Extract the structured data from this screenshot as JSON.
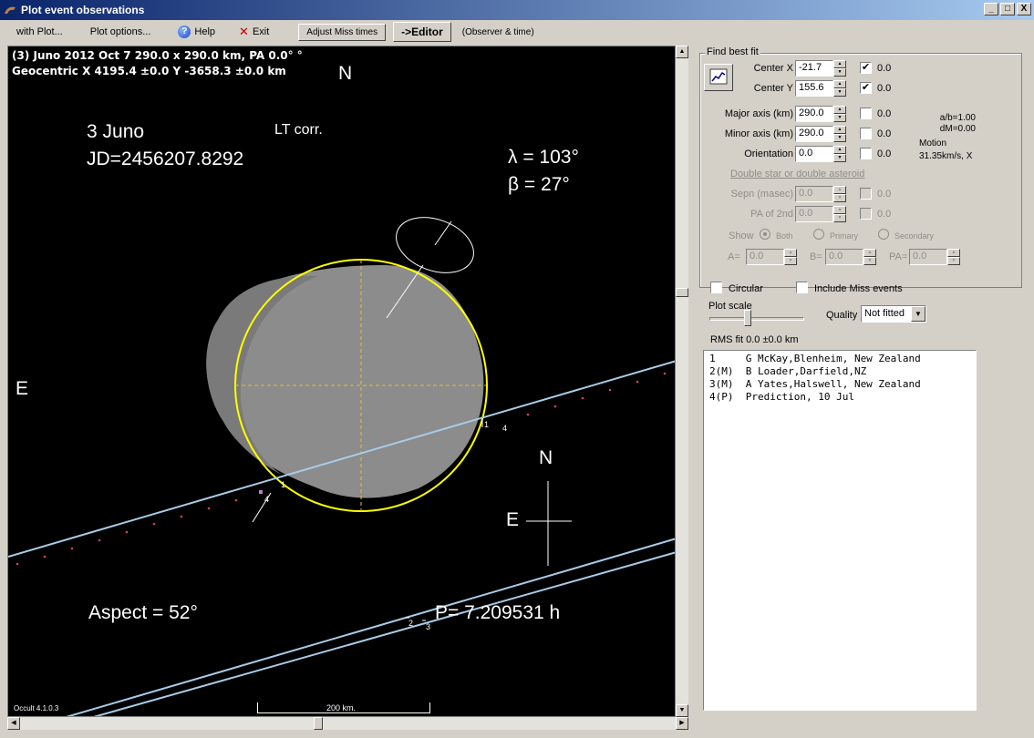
{
  "window": {
    "title": "Plot event observations",
    "controls": {
      "minimize": "_",
      "maximize": "□",
      "close": "X"
    }
  },
  "menu": {
    "with_plot": "with Plot...",
    "plot_options": "Plot options...",
    "help": "Help",
    "exit": "Exit",
    "adjust_miss_times": "Adjust Miss times",
    "editor": "->Editor",
    "observer_time": "(Observer & time)"
  },
  "plot": {
    "header_line1": "(3) Juno  2012 Oct 7   290.0 x 290.0 km, PA 0.0° °",
    "header_line2": "Geocentric X 4195.4 ±0.0  Y -3658.3 ±0.0 km",
    "north_top": "N",
    "east_left": "E",
    "object_name": "3 Juno",
    "lt_corr": "LT corr.",
    "jd": "JD=2456207.8292",
    "lambda": "λ =  103°",
    "beta": "β =   27°",
    "aspect": "Aspect = 52°",
    "period": "P= 7.209531 h",
    "compass_n": "N",
    "compass_e": "E",
    "scale_label": "200 km.",
    "version": "Occult 4.1.0.3",
    "chord_labels": {
      "c1a": "1",
      "c4a": "4",
      "c1b": "1",
      "c4b": "4",
      "c2": "2",
      "c3": "3"
    },
    "colors": {
      "background": "#000000",
      "ellipse": "#ffff00",
      "chord": "#a8cce8",
      "shape": "#8c8c8c",
      "text": "#ffffff",
      "dots": "#d04070"
    }
  },
  "panel": {
    "find_best_fit": "Find best fit",
    "center_x_label": "Center X",
    "center_x_value": "-21.7",
    "center_x_checked": "✔",
    "center_x_unc": "0.0",
    "center_y_label": "Center Y",
    "center_y_value": "155.6",
    "center_y_checked": "✔",
    "center_y_unc": "0.0",
    "major_label": "Major axis (km)",
    "major_value": "290.0",
    "major_unc": "0.0",
    "minor_label": "Minor axis (km)",
    "minor_value": "290.0",
    "minor_unc": "0.0",
    "orient_label": "Orientation",
    "orient_value": "0.0",
    "orient_unc": "0.0",
    "ab_ratio": "a/b=1.00",
    "dm": "dM=0.00",
    "motion_label": "Motion",
    "motion_value": "31.35km/s, X",
    "double_star_link": "Double star  or  double asteroid",
    "sepn_label": "Sepn (masec)",
    "sepn_value": "0.0",
    "sepn_unc": "0.0",
    "pa2_label": "PA of 2nd",
    "pa2_value": "0.0",
    "pa2_unc": "0.0",
    "show_label": "Show",
    "radio_both": "Both",
    "radio_primary": "Primary",
    "radio_secondary": "Secondary",
    "a_label": "A=",
    "a_value": "0.0",
    "b_label": "B=",
    "b_value": "0.0",
    "pa_label": "PA=",
    "pa_value": "0.0",
    "circular": "Circular",
    "include_miss": "Include Miss events",
    "plot_scale": "Plot scale",
    "quality_label": "Quality",
    "quality_value": "Not fitted",
    "rms_fit": "RMS fit 0.0 ±0.0 km"
  },
  "observers": [
    "1     G McKay,Blenheim, New Zealand",
    "2(M)  B Loader,Darfield,NZ",
    "3(M)  A Yates,Halswell, New Zealand",
    "4(P)  Prediction, 10 Jul"
  ]
}
